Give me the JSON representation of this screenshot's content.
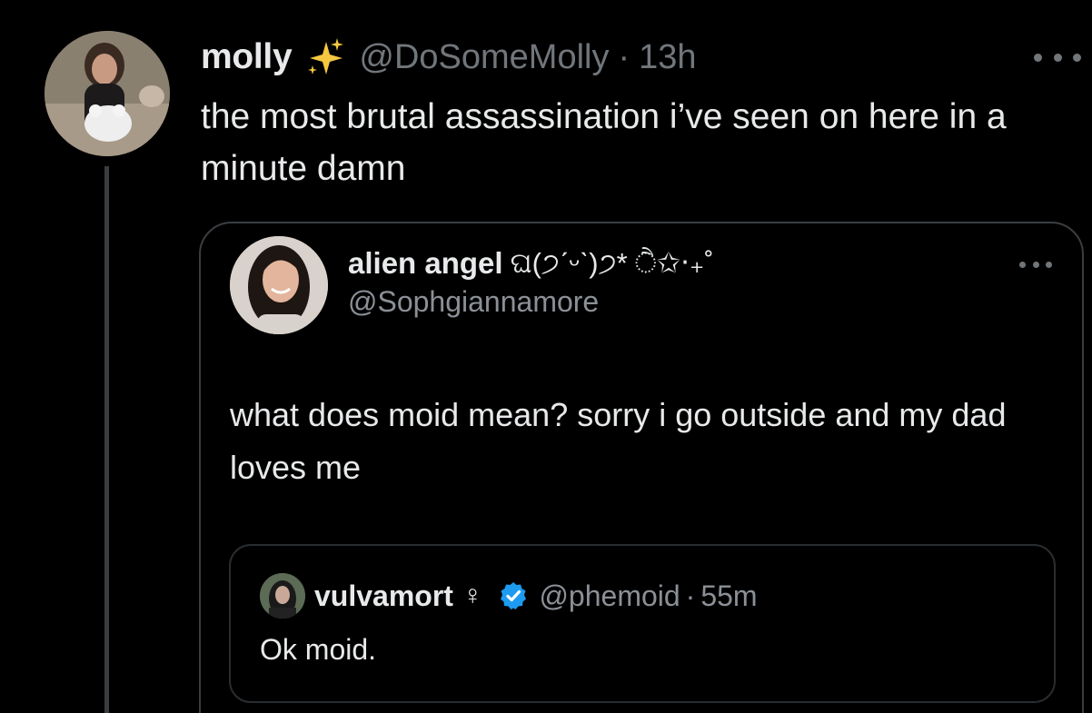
{
  "tweet": {
    "display_name": "molly",
    "name_emoji_icon": "sparkles-icon",
    "handle": "@DoSomeMolly",
    "separator": "·",
    "time": "13h",
    "text": "the most brutal assassination i’ve seen on here in a minute damn"
  },
  "quote": {
    "display_name": "alien angel",
    "kaomoji": "ଘ(੭ˊᵕˋ)੭* ੈ✩‧₊˚",
    "handle": "@Sophgiannamore",
    "text": "what does moid mean?  sorry i go outside and my dad loves me"
  },
  "inner_quote": {
    "display_name": "vulvamort",
    "symbol": "♀",
    "verified_icon": "verified-badge-icon",
    "handle": "@phemoid",
    "separator": "·",
    "time": "55m",
    "text": "Ok moid."
  },
  "colors": {
    "background": "#000000",
    "text": "#e7e9ea",
    "secondary_text": "#71767b",
    "border": "#3a3d40",
    "verified_blue": "#1d9bf0"
  }
}
